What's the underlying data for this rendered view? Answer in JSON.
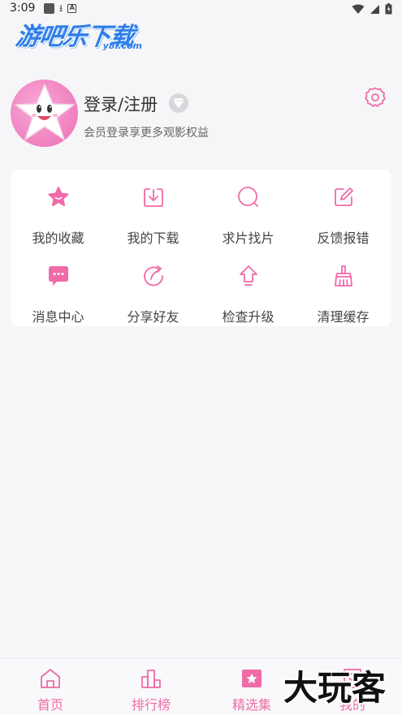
{
  "status_bar": {
    "time": "3:09"
  },
  "logo": {
    "title": "游吧乐下载",
    "subtitle": "y8l.com"
  },
  "profile": {
    "title": "登录/注册",
    "subtitle": "会员登录享更多观影权益"
  },
  "menu": {
    "items": [
      {
        "label": "我的收藏",
        "icon": "star-icon"
      },
      {
        "label": "我的下载",
        "icon": "download-icon"
      },
      {
        "label": "求片找片",
        "icon": "search-icon"
      },
      {
        "label": "反馈报错",
        "icon": "edit-icon"
      },
      {
        "label": "消息中心",
        "icon": "message-icon"
      },
      {
        "label": "分享好友",
        "icon": "share-icon"
      },
      {
        "label": "检查升级",
        "icon": "upgrade-icon"
      },
      {
        "label": "清理缓存",
        "icon": "broom-icon"
      }
    ]
  },
  "bottom_nav": {
    "items": [
      {
        "label": "首页",
        "icon": "home-icon"
      },
      {
        "label": "排行榜",
        "icon": "ranking-icon"
      },
      {
        "label": "精选集",
        "icon": "collection-icon"
      },
      {
        "label": "我的",
        "icon": "profile-icon"
      }
    ]
  },
  "watermark": {
    "text": "大玩客"
  },
  "colors": {
    "accent": "#f06aa8",
    "background": "#f6f6f8",
    "card": "#ffffff",
    "logo_blue": "#2f7ee8"
  }
}
